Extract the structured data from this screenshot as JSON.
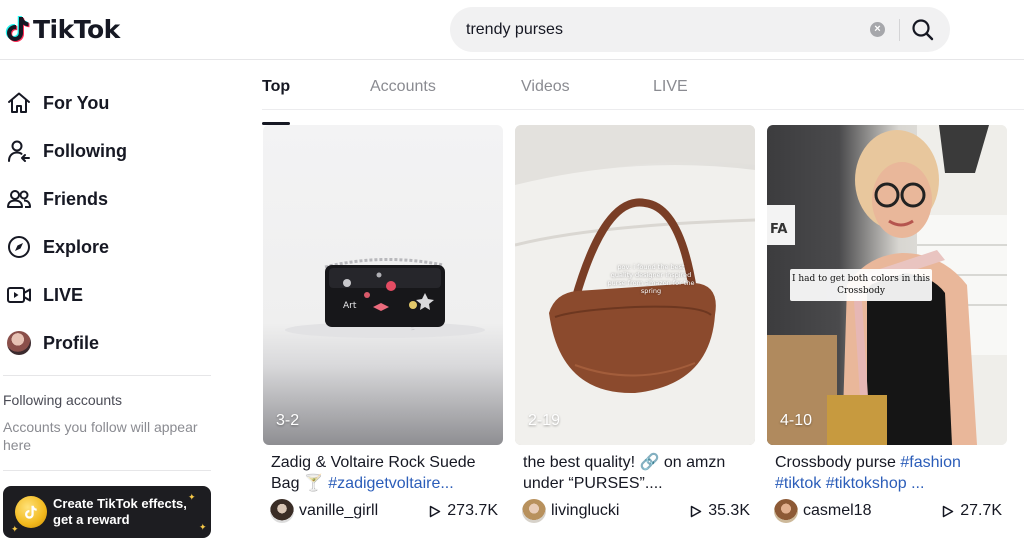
{
  "brand": {
    "name": "TikTok"
  },
  "search": {
    "value": "trendy purses"
  },
  "sidebar": {
    "items": [
      {
        "label": "For You",
        "icon": "home-icon"
      },
      {
        "label": "Following",
        "icon": "following-icon"
      },
      {
        "label": "Friends",
        "icon": "friends-icon"
      },
      {
        "label": "Explore",
        "icon": "compass-icon"
      },
      {
        "label": "LIVE",
        "icon": "live-icon"
      },
      {
        "label": "Profile",
        "icon": "avatar"
      }
    ],
    "following_title": "Following accounts",
    "following_desc": "Accounts you follow will appear here",
    "effects_banner": "Create TikTok effects, get a reward"
  },
  "tabs": [
    {
      "label": "Top",
      "active": true
    },
    {
      "label": "Accounts",
      "active": false
    },
    {
      "label": "Videos",
      "active": false
    },
    {
      "label": "LIVE",
      "active": false
    }
  ],
  "results": [
    {
      "date": "3-2",
      "caption_text": "Zadig & Voltaire Rock Suede Bag 🍸 ",
      "caption_tags": "#zadigetvoltaire...",
      "author": "vanille_girll",
      "views": "273.7K"
    },
    {
      "date": "2-19",
      "caption_text": "the best quality! 🔗 on amzn under “PURSES”....",
      "caption_tags": "",
      "overlay_text": "pov: i found the best quality designer inspired purse from amazon for the spring",
      "author": "livinglucki",
      "views": "35.3K"
    },
    {
      "date": "4-10",
      "caption_text": "Crossbody purse ",
      "caption_tags": "#fashion #tiktok #tiktokshop ...",
      "overlay_text": "I had to get both colors in this Crossbody",
      "author": "casmel18",
      "views": "27.7K"
    }
  ],
  "colors": {
    "hashtag": "#2b5db9",
    "text_primary": "#161823",
    "text_secondary": "#8a8b91",
    "banner_bg": "#1d1d21",
    "search_bg": "#f1f1f2"
  }
}
